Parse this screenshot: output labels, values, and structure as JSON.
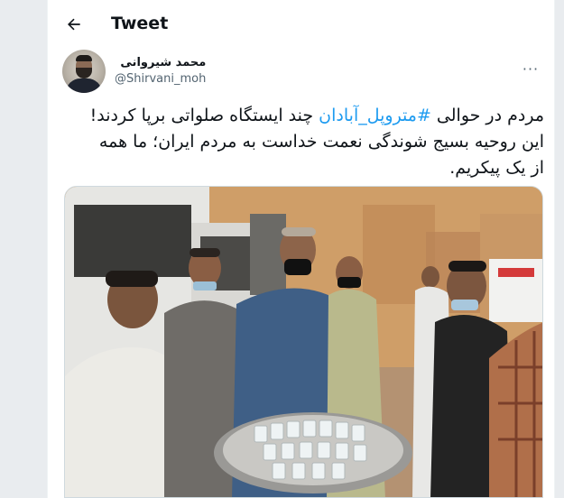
{
  "header": {
    "title": "Tweet",
    "back_icon": "arrow-left-icon"
  },
  "author": {
    "display_name": "محمد شیروانی",
    "handle": "@Shirvani_moh",
    "avatar_icon": "avatar"
  },
  "more_icon": "more-horizontal-icon",
  "more_label": "···",
  "tweet": {
    "text_before": "مردم در حوالی ",
    "hashtag": "#متروپل_آبادان",
    "text_after": " چند ایستگاه صلواتی برپا کردند! این روحیه بسیج شوندگی نعمت خداست به مردم ایران؛ ما همه از یک پیکریم."
  },
  "media": {
    "kind": "photo"
  },
  "colors": {
    "accent": "#1d9bf0",
    "text": "#0f1419",
    "secondary": "#536471",
    "border": "#cfd9de"
  }
}
